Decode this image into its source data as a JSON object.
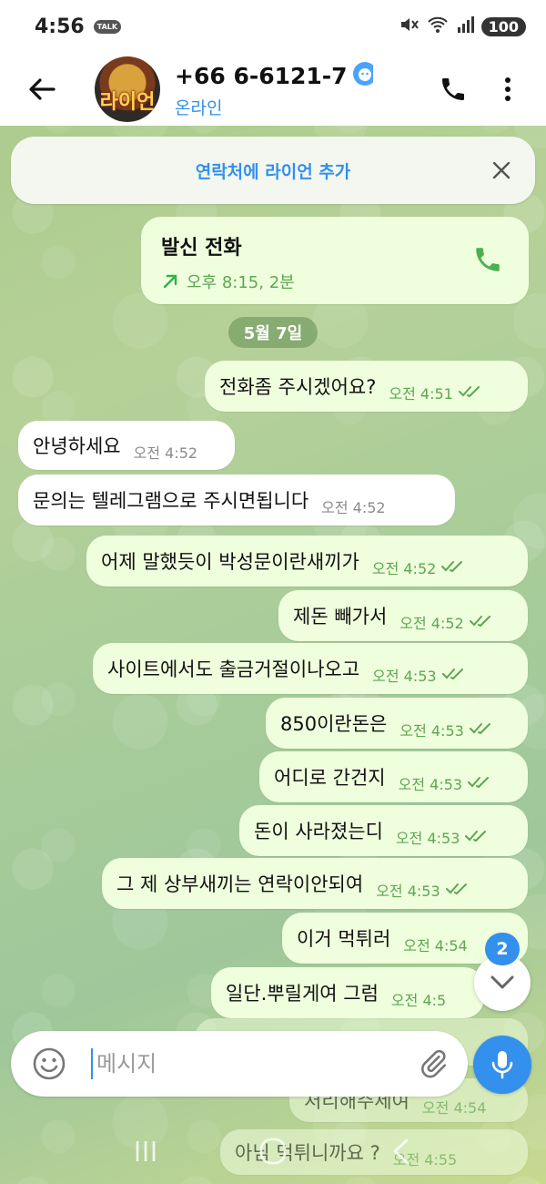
{
  "statusbar": {
    "time": "4:56",
    "talk_badge": "TALK",
    "battery": "100"
  },
  "header": {
    "avatar_text": "라이언",
    "title": "+66 6-6121-7",
    "status": "온라인"
  },
  "banner": {
    "label": "연락처에 라이언 추가"
  },
  "call": {
    "title": "발신 전화",
    "detail": "오후 8:15, 2분"
  },
  "date": "5월 7일",
  "messages": [
    {
      "dir": "out",
      "text": "전화좀 주시겠어요?",
      "time": "오전 4:51"
    },
    {
      "dir": "in",
      "text": "안녕하세요",
      "time": "오전 4:52"
    },
    {
      "dir": "in",
      "text": "문의는 텔레그램으로 주시면됩니다",
      "time": "오전 4:52"
    },
    {
      "dir": "out",
      "text": "어제 말했듯이 박성문이란새끼가",
      "time": "오전 4:52"
    },
    {
      "dir": "out",
      "text": "제돈 빼가서",
      "time": "오전 4:52"
    },
    {
      "dir": "out",
      "text": "사이트에서도 출금거절이나오고",
      "time": "오전 4:53"
    },
    {
      "dir": "out",
      "text": "850이란돈은",
      "time": "오전 4:53"
    },
    {
      "dir": "out",
      "text": "어디로 간건지",
      "time": "오전 4:53"
    },
    {
      "dir": "out",
      "text": "돈이 사라졌는디",
      "time": "오전 4:53"
    },
    {
      "dir": "out",
      "text": "그 제 상부새끼는 연락이안되여",
      "time": "오전 4:53"
    },
    {
      "dir": "out",
      "text": "이거 먹튀러",
      "time": "오전 4:54"
    },
    {
      "dir": "out",
      "text": "일단.뿌릴게여 그럼",
      "time": "오전 4:5"
    },
    {
      "dir": "out",
      "text": "처리해주세여",
      "time": "오전 4:54"
    },
    {
      "dir": "out",
      "text": "아님 먹튀니까요 ?",
      "time": "오전 4:55"
    }
  ],
  "fab": {
    "count": "2"
  },
  "input": {
    "placeholder": "메시지"
  },
  "colors": {
    "accent": "#3390ec",
    "outgoing_bubble": "#effedd",
    "incoming_bubble": "#ffffff",
    "tick_green": "#5ea653"
  }
}
